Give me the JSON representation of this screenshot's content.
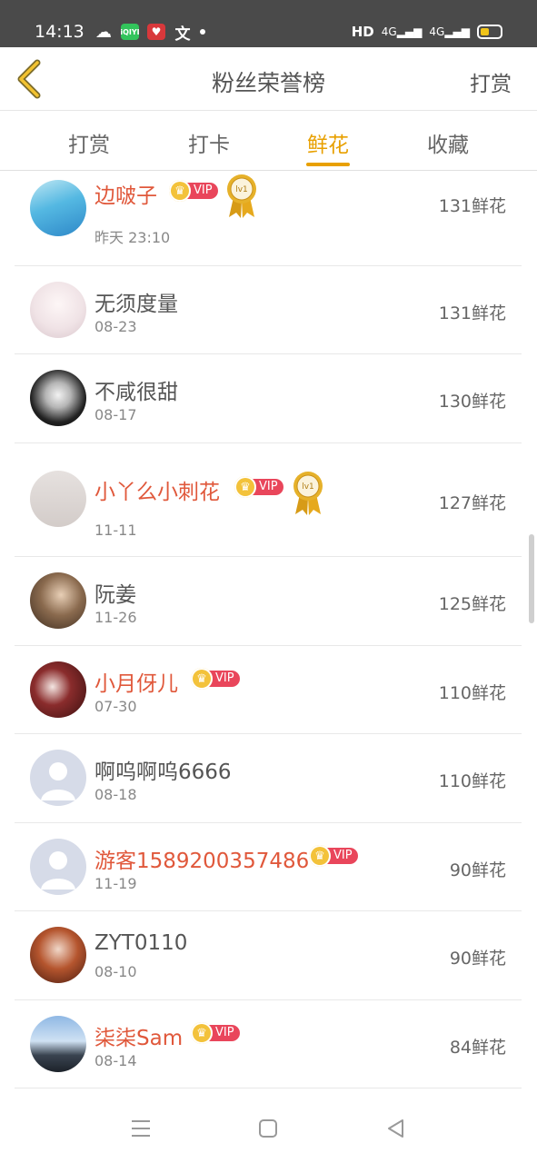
{
  "status_bar": {
    "time": "14:13",
    "hd": "HD",
    "net1": "4G",
    "net2": "4G"
  },
  "header": {
    "title": "粉丝荣誉榜",
    "right_action": "打赏"
  },
  "tabs": [
    {
      "label": "打赏",
      "active": false
    },
    {
      "label": "打卡",
      "active": false
    },
    {
      "label": "鲜花",
      "active": true
    },
    {
      "label": "收藏",
      "active": false
    }
  ],
  "vip_label": "VIP",
  "medal_label": "lv1",
  "list": [
    {
      "name": "边啵子",
      "date": "昨天 23:10",
      "amount": "131鲜花",
      "vip": true,
      "medal": true
    },
    {
      "name": "无须度量",
      "date": "08-23",
      "amount": "131鲜花",
      "vip": false,
      "medal": false
    },
    {
      "name": "不咸很甜",
      "date": "08-17",
      "amount": "130鲜花",
      "vip": false,
      "medal": false
    },
    {
      "name": "小丫么小刺花",
      "date": "11-11",
      "amount": "127鲜花",
      "vip": true,
      "medal": true
    },
    {
      "name": "阮姜",
      "date": "11-26",
      "amount": "125鲜花",
      "vip": false,
      "medal": false
    },
    {
      "name": "小月伢儿",
      "date": "07-30",
      "amount": "110鲜花",
      "vip": true,
      "medal": false
    },
    {
      "name": "啊呜啊呜6666",
      "date": "08-18",
      "amount": "110鲜花",
      "vip": false,
      "medal": false
    },
    {
      "name": "游客1589200357486",
      "date": "11-19",
      "amount": "90鲜花",
      "vip": true,
      "medal": false
    },
    {
      "name": "ZYT0110",
      "date": "08-10",
      "amount": "90鲜花",
      "vip": false,
      "medal": false
    },
    {
      "name": "柒柒Sam",
      "date": "08-14",
      "amount": "84鲜花",
      "vip": true,
      "medal": false
    }
  ],
  "colors": {
    "accent": "#e8a000",
    "vip_name": "#e0583b",
    "vip_badge": "#e9465b",
    "status_bar": "#4a4a4a"
  }
}
